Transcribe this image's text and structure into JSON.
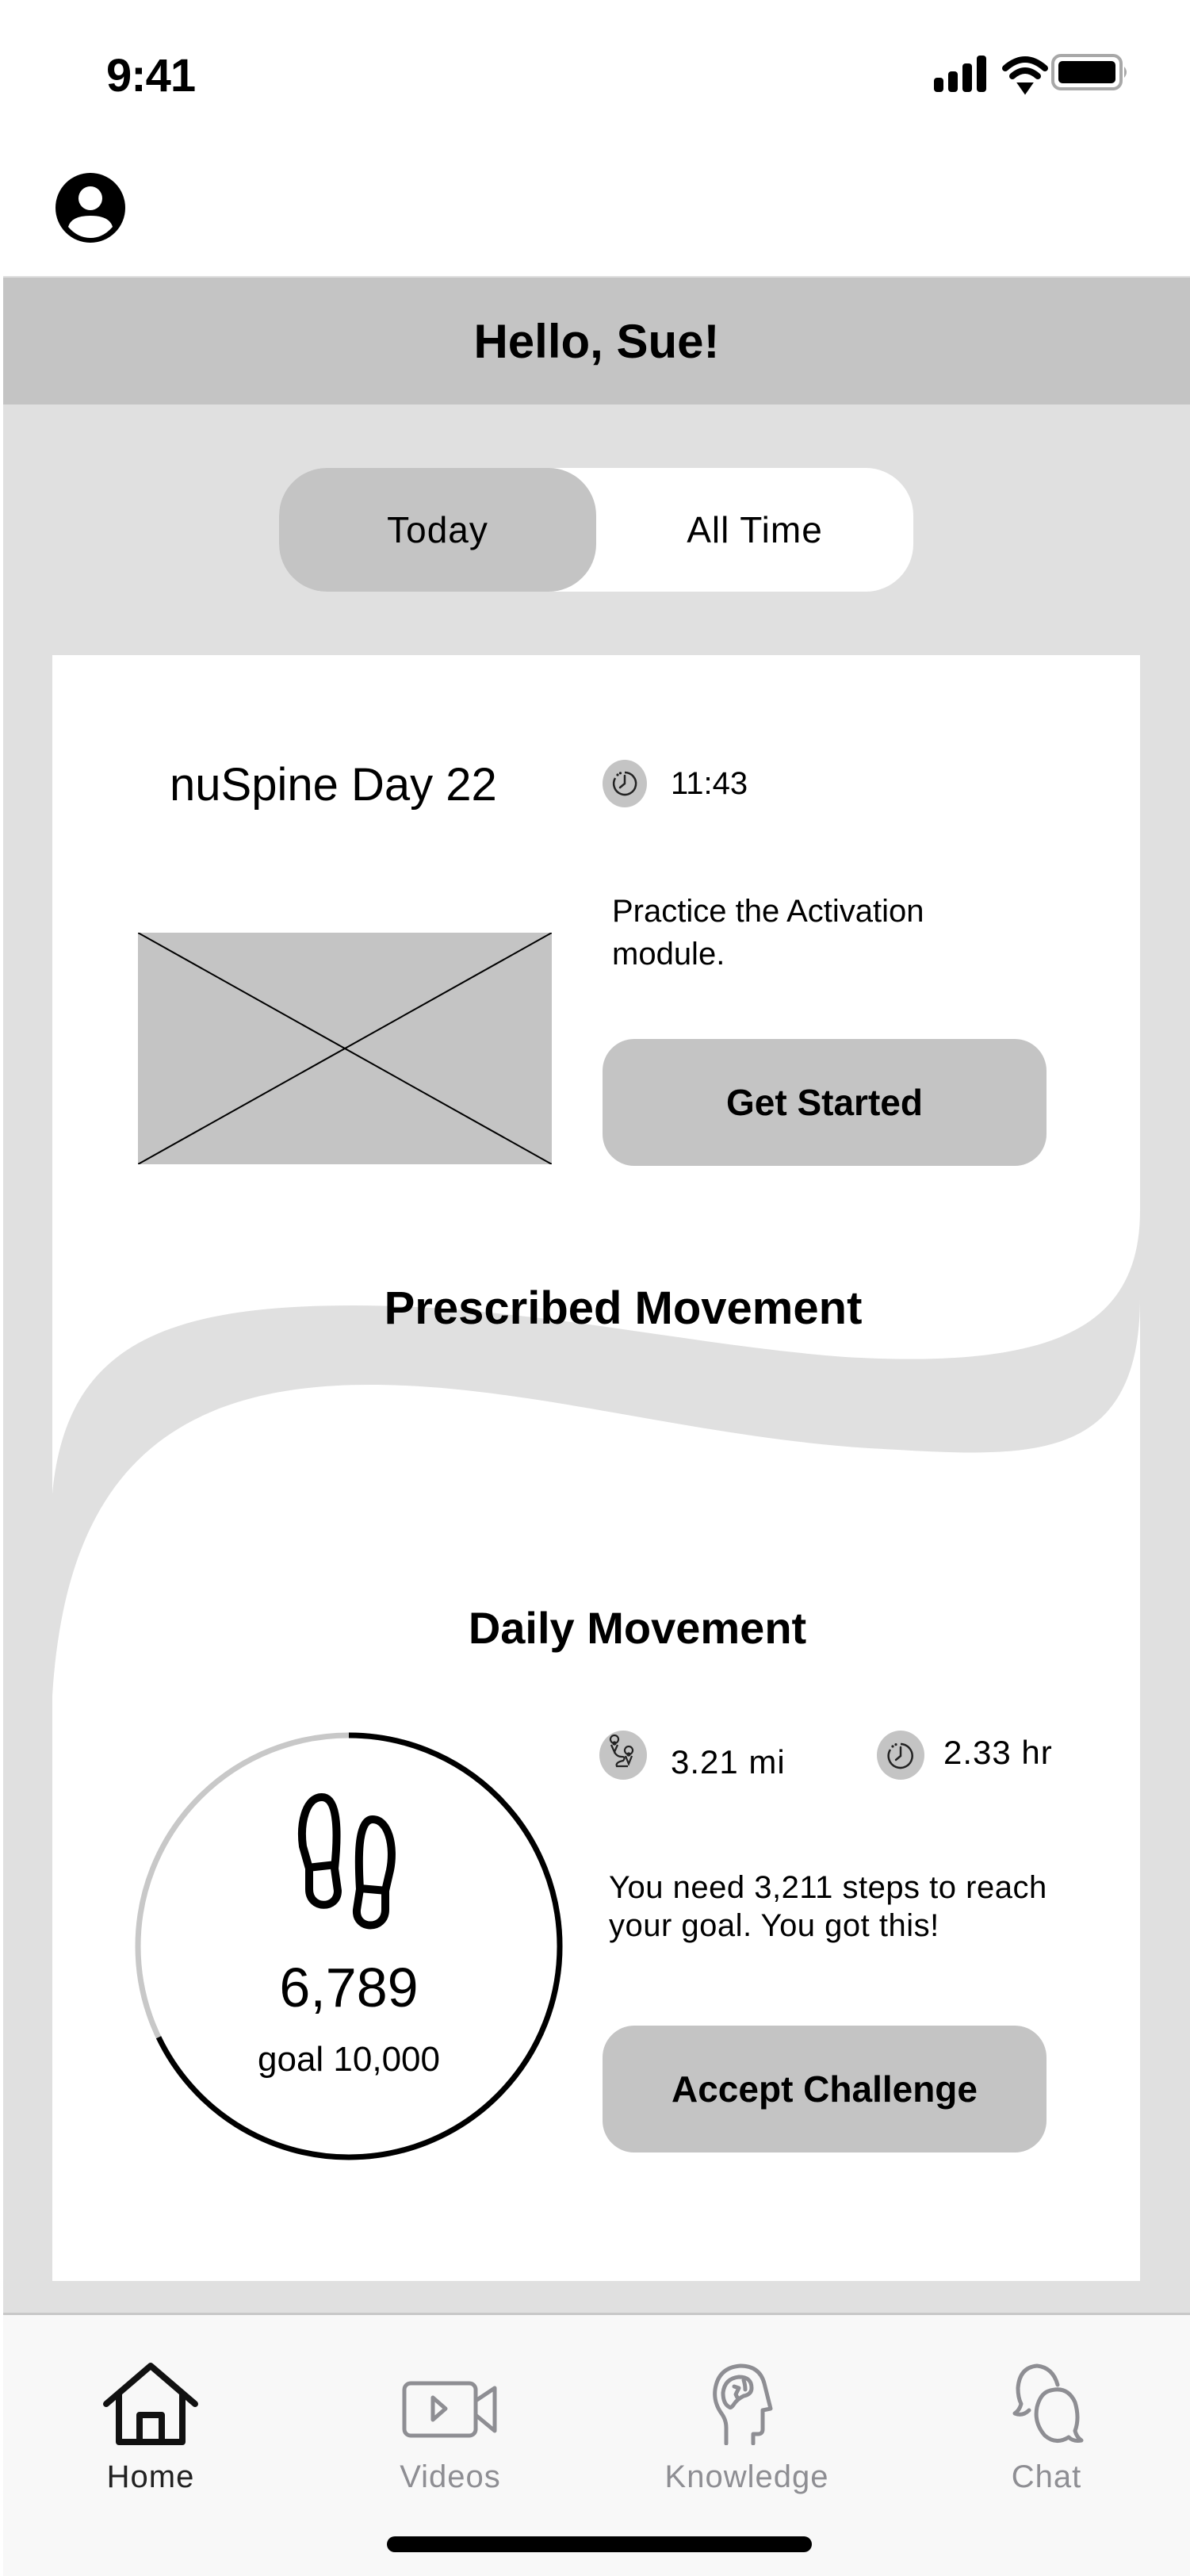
{
  "status_bar": {
    "time": "9:41",
    "icons": [
      "cellular-signal-icon",
      "wifi-icon",
      "battery-icon"
    ]
  },
  "header": {
    "avatar_icon": "user-avatar-icon",
    "greeting": "Hello, Sue!"
  },
  "segmented_control": {
    "options": [
      {
        "label": "Today",
        "selected": true
      },
      {
        "label": "All Time",
        "selected": false
      }
    ]
  },
  "program_card": {
    "title": "nuSpine Day 22",
    "timer_icon": "stopwatch-icon",
    "timer_value": "11:43",
    "thumbnail": "image-placeholder",
    "description": "Practice the Activation module.",
    "cta_label": "Get Started"
  },
  "prescribed_movement": {
    "title": "Prescribed Movement"
  },
  "daily_movement": {
    "title": "Daily Movement",
    "steps_icon": "footprints-icon",
    "steps": "6,789",
    "goal_label": "goal 10,000",
    "steps_count": 6789,
    "goal_count": 10000,
    "progress_fraction": 0.6789,
    "distance_icon": "route-icon",
    "distance": "3.21 mi",
    "duration_icon": "stopwatch-icon",
    "duration": "2.33 hr",
    "message": "You need 3,211 steps to reach your goal. You got this!",
    "cta_label": "Accept Challenge"
  },
  "tab_bar": {
    "tabs": [
      {
        "label": "Home",
        "icon": "home-icon",
        "active": true
      },
      {
        "label": "Videos",
        "icon": "video-camera-icon",
        "active": false
      },
      {
        "label": "Knowledge",
        "icon": "brain-head-icon",
        "active": false
      },
      {
        "label": "Chat",
        "icon": "chat-bubbles-icon",
        "active": false
      }
    ]
  },
  "colors": {
    "background": "#e0e0e0",
    "header": "#c4c4c4",
    "accent_fill": "#c4c4c4",
    "card": "#ffffff",
    "inactive_tab": "#8e8e93",
    "active_tab": "#222222",
    "ring_progress": "#000000",
    "ring_track": "#c8c8c8"
  }
}
